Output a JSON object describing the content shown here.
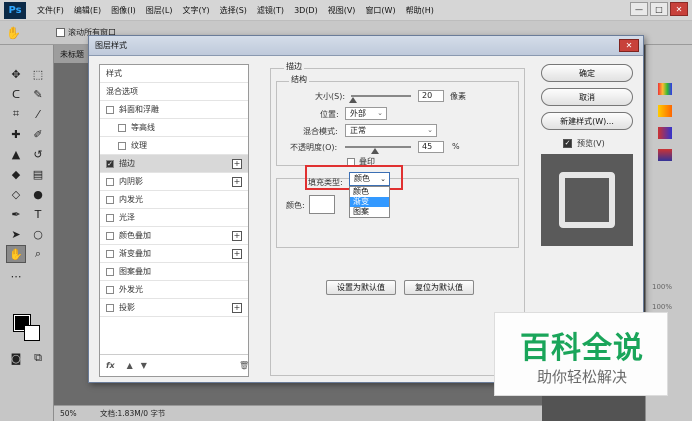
{
  "menubar": {
    "logo": "Ps",
    "items": [
      "文件(F)",
      "编辑(E)",
      "图像(I)",
      "图层(L)",
      "文字(Y)",
      "选择(S)",
      "滤镜(T)",
      "3D(D)",
      "视图(V)",
      "窗口(W)",
      "帮助(H)"
    ],
    "min": "—",
    "max": "□",
    "close": "✕"
  },
  "optbar": {
    "scroll_all": "滚动所有窗口"
  },
  "doc_tab": "未标题",
  "status": {
    "zoom": "50%",
    "doc": "文档:1.83M/0 字节"
  },
  "dialog": {
    "title": "图层样式",
    "close": "✕",
    "styles_header": "样式",
    "blend_options": "混合选项",
    "style_items": [
      {
        "label": "斜面和浮雕",
        "checked": false,
        "plus": false
      },
      {
        "label": "等高线",
        "checked": false,
        "plus": false
      },
      {
        "label": "纹理",
        "checked": false,
        "plus": false
      },
      {
        "label": "描边",
        "checked": true,
        "plus": true
      },
      {
        "label": "内阴影",
        "checked": false,
        "plus": true
      },
      {
        "label": "内发光",
        "checked": false,
        "plus": false
      },
      {
        "label": "光泽",
        "checked": false,
        "plus": false
      },
      {
        "label": "颜色叠加",
        "checked": false,
        "plus": true
      },
      {
        "label": "渐变叠加",
        "checked": false,
        "plus": true
      },
      {
        "label": "图案叠加",
        "checked": false,
        "plus": false
      },
      {
        "label": "外发光",
        "checked": false,
        "plus": false
      },
      {
        "label": "投影",
        "checked": false,
        "plus": true
      }
    ],
    "list_footer": "fx",
    "stroke": {
      "group_label": "描边",
      "structure_label": "结构",
      "size_label": "大小(S):",
      "size_value": "20",
      "size_unit": "像素",
      "size_fraction": 0.04,
      "position_label": "位置:",
      "position_value": "外部",
      "blend_label": "混合模式:",
      "blend_value": "正常",
      "opacity_label": "不透明度(O):",
      "opacity_value": "45",
      "opacity_unit": "%",
      "opacity_fraction": 0.45,
      "emboss_label": "叠印",
      "fill_type_label": "填充类型:",
      "fill_type_value": "颜色",
      "fill_options": [
        "颜色",
        "渐变",
        "图案"
      ],
      "fill_highlight_index": 1,
      "color_label": "颜色:",
      "set_default": "设置为默认值",
      "reset_default": "复位为默认值"
    },
    "buttons": {
      "ok": "确定",
      "cancel": "取消",
      "new_style": "新建样式(W)...",
      "preview": "预览(V)"
    }
  },
  "right_panel": {
    "pct1": "100%",
    "pct2": "100%"
  },
  "watermark": {
    "title": "百科全说",
    "subtitle": "助你轻松解决"
  }
}
